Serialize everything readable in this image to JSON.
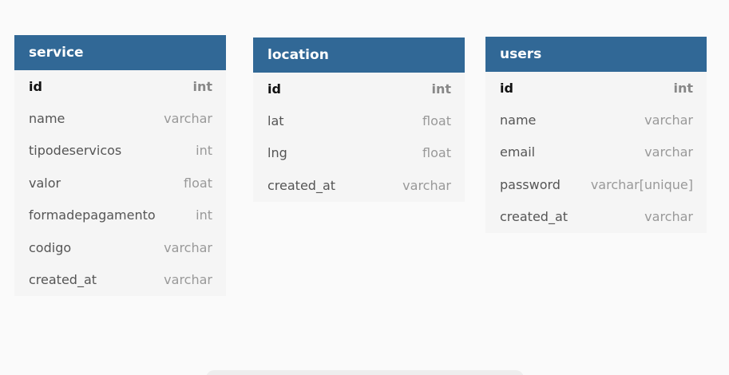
{
  "tables": [
    {
      "name": "service",
      "fields": [
        {
          "name": "id",
          "type": "int",
          "pk": true
        },
        {
          "name": "name",
          "type": "varchar"
        },
        {
          "name": "tipodeservicos",
          "type": "int"
        },
        {
          "name": "valor",
          "type": "float"
        },
        {
          "name": "formadepagamento",
          "type": "int"
        },
        {
          "name": "codigo",
          "type": "varchar"
        },
        {
          "name": "created_at",
          "type": "varchar"
        }
      ]
    },
    {
      "name": "location",
      "fields": [
        {
          "name": "id",
          "type": "int",
          "pk": true
        },
        {
          "name": "lat",
          "type": "float"
        },
        {
          "name": "lng",
          "type": "float"
        },
        {
          "name": "created_at",
          "type": "varchar"
        }
      ]
    },
    {
      "name": "users",
      "fields": [
        {
          "name": "id",
          "type": "int",
          "pk": true
        },
        {
          "name": "name",
          "type": "varchar"
        },
        {
          "name": "email",
          "type": "varchar"
        },
        {
          "name": "password",
          "type": "varchar[unique]"
        },
        {
          "name": "created_at",
          "type": "varchar"
        }
      ]
    }
  ],
  "colors": {
    "header_bg": "#316896",
    "header_text": "#ffffff",
    "body_bg": "#f5f5f5"
  }
}
